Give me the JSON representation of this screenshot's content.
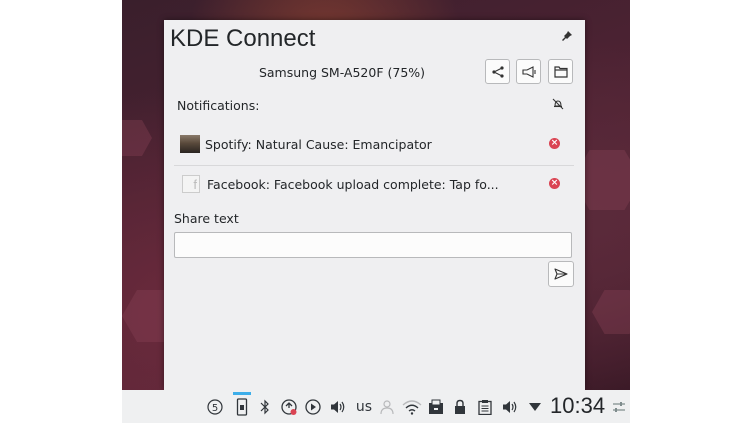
{
  "popup": {
    "title": "KDE Connect",
    "device": "Samsung SM-A520F (75%)",
    "notifications_label": "Notifications:",
    "notifications": [
      {
        "text": "Spotify: Natural Cause: Emancipator",
        "icon": "spotify-album-thumbnail"
      },
      {
        "text": "Facebook: Facebook upload complete: Tap fo...",
        "icon": "facebook-icon"
      }
    ],
    "share_label": "Share text",
    "share_value": ""
  },
  "panel": {
    "layout": "us",
    "time": "10:34"
  },
  "colors": {
    "accent": "#3daee9",
    "close_red": "#da4453"
  }
}
